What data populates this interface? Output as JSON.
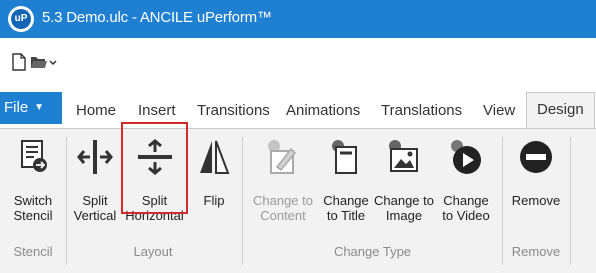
{
  "window": {
    "title": "5.3 Demo.ulc - ANCILE uPerform™"
  },
  "quick_access": {
    "new_doc_icon": "document-icon",
    "open_icon": "folder-icon",
    "dropdown_icon": "chevron-down-icon"
  },
  "tabs": {
    "file": "File",
    "items": [
      "Home",
      "Insert",
      "Transitions",
      "Animations",
      "Translations",
      "View",
      "Design"
    ],
    "active": "Design"
  },
  "ribbon": {
    "stencil": {
      "switch_stencil": "Switch\nStencil",
      "group": "Stencil"
    },
    "layout": {
      "split_vertical": "Split\nVertical",
      "split_horizontal": "Split\nHorizontal",
      "flip": "Flip",
      "group": "Layout"
    },
    "change_type": {
      "change_to_content": "Change to\nContent",
      "change_to_title": "Change\nto Title",
      "change_to_image": "Change to\nImage",
      "change_to_video": "Change\nto Video",
      "group": "Change Type"
    },
    "remove": {
      "remove": "Remove",
      "group": "Remove"
    }
  },
  "colors": {
    "accent": "#1f7fd0",
    "highlight": "#d32a2a",
    "ribbon_bg": "#f2f2f2"
  }
}
